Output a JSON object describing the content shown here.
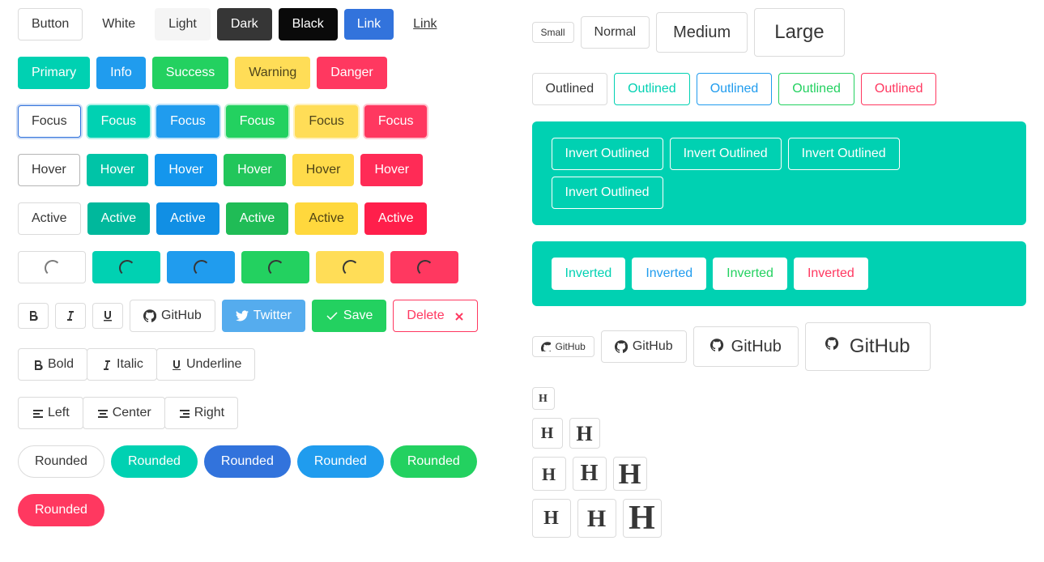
{
  "row1": {
    "button": "Button",
    "white": "White",
    "light": "Light",
    "dark": "Dark",
    "black": "Black",
    "link": "Link",
    "link2": "Link"
  },
  "row2": {
    "primary": "Primary",
    "info": "Info",
    "success": "Success",
    "warning": "Warning",
    "danger": "Danger"
  },
  "focus": "Focus",
  "hover": "Hover",
  "active": "Active",
  "github": "GitHub",
  "twitter": "Twitter",
  "save": "Save",
  "delete": "Delete",
  "bold": "Bold",
  "italic": "Italic",
  "underline": "Underline",
  "left": "Left",
  "center": "Center",
  "right": "Right",
  "rounded": "Rounded",
  "sizes": {
    "small": "Small",
    "normal": "Normal",
    "medium": "Medium",
    "large": "Large"
  },
  "outlined": "Outlined",
  "invert_outlined": "Invert Outlined",
  "inverted": "Inverted",
  "h": "H"
}
